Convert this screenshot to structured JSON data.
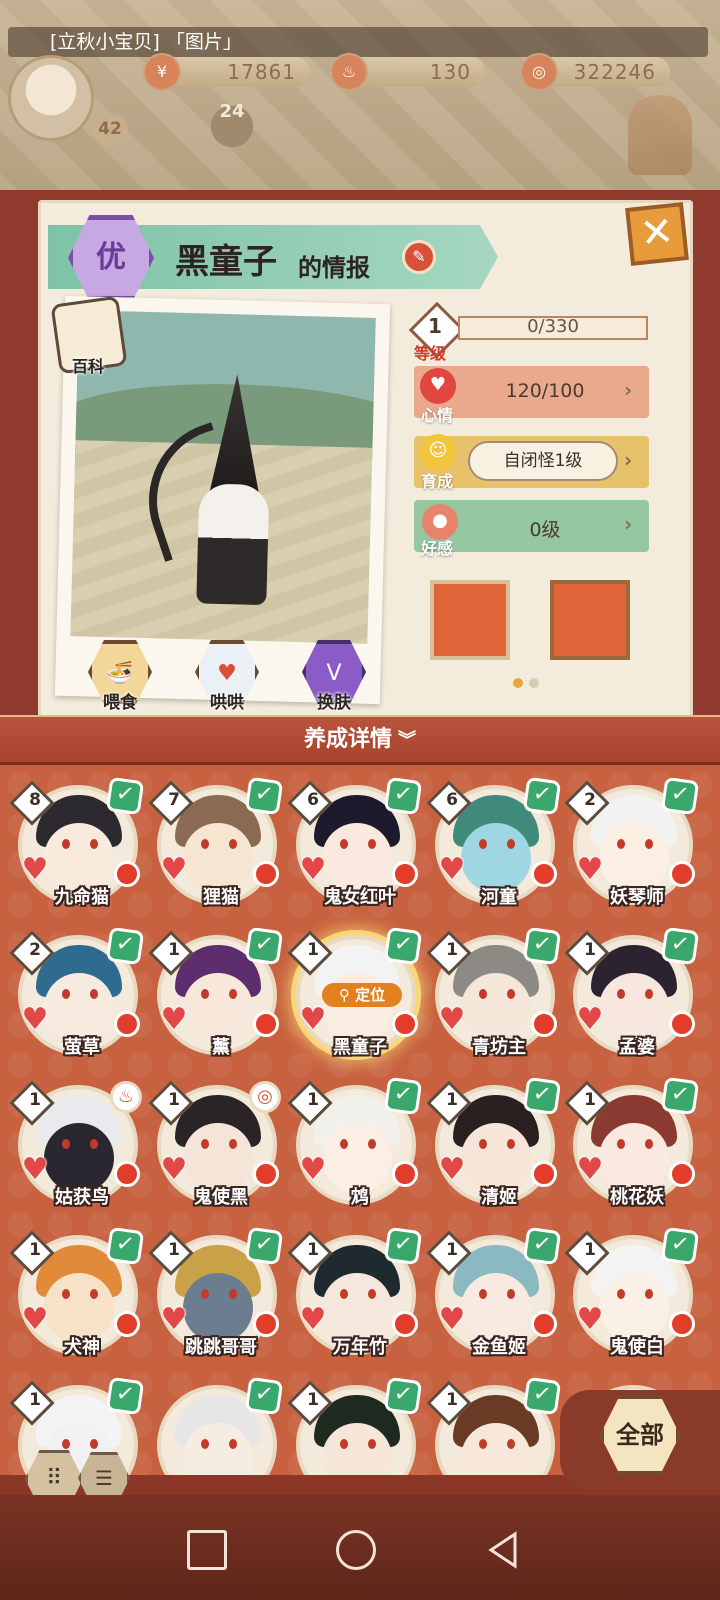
{
  "hud": {
    "chat_title": "[立秋小宝贝] 「图片」",
    "player_level": "42",
    "currency_1": "17861",
    "currency_2": "130",
    "currency_3": "322246",
    "day_label": "24"
  },
  "info": {
    "rarity": "优",
    "name": "黑童子",
    "name_suffix": "的情报",
    "wiki_label": "百科",
    "level_label": "等级",
    "level": "1",
    "exp": "0/330",
    "mood_label": "心情",
    "mood_value": "120/100",
    "nurture_label": "育成",
    "nurture_value": "自闭怪1级",
    "favor_label": "好感",
    "favor_value": "0级",
    "actions": [
      "喂食",
      "哄哄",
      "换肤"
    ],
    "carousel_active": 0
  },
  "detail_bar": {
    "label": "养成详情",
    "chevron": "⌄"
  },
  "characters": [
    {
      "name": "九命猫",
      "level": "8",
      "status": "check",
      "hair": "#2c2a2e",
      "face": "#f8eadc"
    },
    {
      "name": "狸猫",
      "level": "7",
      "status": "check",
      "hair": "#8a6a52",
      "face": "#f6e5d0"
    },
    {
      "name": "鬼女红叶",
      "level": "6",
      "status": "check",
      "hair": "#1e1a2e",
      "face": "#fae9de"
    },
    {
      "name": "河童",
      "level": "6",
      "status": "check",
      "hair": "#3f8a7a",
      "face": "#9fd6e3"
    },
    {
      "name": "妖琴师",
      "level": "2",
      "status": "check",
      "hair": "#f2f2f2",
      "face": "#fbefe3"
    },
    {
      "name": "萤草",
      "level": "2",
      "status": "check",
      "hair": "#2f6b8f",
      "face": "#f7eadf"
    },
    {
      "name": "薰",
      "level": "1",
      "status": "check",
      "hair": "#5c2e6e",
      "face": "#f8e8dc"
    },
    {
      "name": "黑童子",
      "level": "1",
      "status": "check",
      "hair": "#f3f3f3",
      "face": "#f9ece1",
      "selected": true,
      "tag": "定位"
    },
    {
      "name": "青坊主",
      "level": "1",
      "status": "check",
      "hair": "#8d8a86",
      "face": "#f4e6d8"
    },
    {
      "name": "孟婆",
      "level": "1",
      "status": "check",
      "hair": "#2b2430",
      "face": "#f7e7de"
    },
    {
      "name": "姑获鸟",
      "level": "1",
      "status": "chef",
      "hair": "#e9e9ee",
      "face": "#2a2730"
    },
    {
      "name": "鬼使黑",
      "level": "1",
      "status": "target",
      "hair": "#2a2426",
      "face": "#f5e4d8"
    },
    {
      "name": "鸩",
      "level": "1",
      "status": "check",
      "hair": "#f2f0ea",
      "face": "#fbeee5"
    },
    {
      "name": "清姬",
      "level": "1",
      "status": "check",
      "hair": "#2b2020",
      "face": "#f7e5da"
    },
    {
      "name": "桃花妖",
      "level": "1",
      "status": "check",
      "hair": "#8a3a30",
      "face": "#f9e9e0"
    },
    {
      "name": "犬神",
      "level": "1",
      "status": "check",
      "hair": "#e08a3a",
      "face": "#f7e2c7"
    },
    {
      "name": "跳跳哥哥",
      "level": "1",
      "status": "check",
      "hair": "#c9a248",
      "face": "#6b7d8e"
    },
    {
      "name": "万年竹",
      "level": "1",
      "status": "check",
      "hair": "#1f2a2e",
      "face": "#f6e7dc"
    },
    {
      "name": "金鱼姬",
      "level": "1",
      "status": "check",
      "hair": "#8ab9c2",
      "face": "#f8eae0"
    },
    {
      "name": "鬼使白",
      "level": "1",
      "status": "check",
      "hair": "#f3f3f3",
      "face": "#fbf0e6"
    },
    {
      "name": "",
      "level": "1",
      "status": "check",
      "hair": "#f4f4f6",
      "face": "#f2f0f3"
    },
    {
      "name": "",
      "level": "",
      "status": "check",
      "hair": "#e6e6e6",
      "face": "#f6ece2"
    },
    {
      "name": "",
      "level": "1",
      "status": "check",
      "hair": "#1e2a20",
      "face": "#f5e6d9"
    },
    {
      "name": "",
      "level": "1",
      "status": "check",
      "hair": "#6b3a24",
      "face": "#f8e8dc"
    },
    {
      "name": "",
      "level": "",
      "status": "none",
      "hair": "#d0b49a",
      "face": "#f5e6d9"
    }
  ],
  "bottom": {
    "all_label": "全部"
  },
  "colors": {
    "panel_red": "#c7613f",
    "check_green": "#3aa76d",
    "heart_red": "#e24848"
  }
}
